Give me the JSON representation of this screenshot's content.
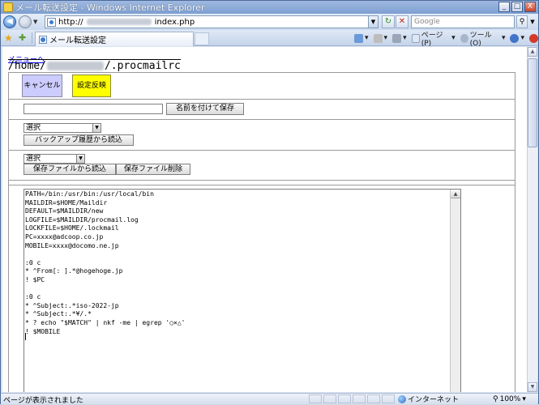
{
  "window": {
    "title": "メール転送設定 - Windows Internet Explorer",
    "controls": {
      "minimize": "_",
      "maximize": "□",
      "close": "X"
    }
  },
  "address_bar": {
    "url_prefix": "http://",
    "url_suffix": "index.php",
    "search_placeholder": "Google"
  },
  "tab": {
    "title": "メール転送設定"
  },
  "command_bar": {
    "page_label": "ページ(P)",
    "tools_label": "ツール(O)"
  },
  "page": {
    "menu_link": "メニューへ",
    "path_prefix": "/home/",
    "path_suffix": "/.procmailrc",
    "cancel_button": "キャンセル",
    "apply_button": "設定反映",
    "save_as_button": "名前を付けて保存",
    "backup_select_value": "選択",
    "backup_load_button": "バックアップ履歴から読込",
    "saved_select_value": "選択",
    "load_saved_button": "保存ファイルから読込",
    "delete_saved_button": "保存ファイル削除",
    "editor_content": "PATH=/bin:/usr/bin:/usr/local/bin\nMAILDIR=$HOME/Maildir\nDEFAULT=$MAILDIR/new\nLOGFILE=$MAILDIR/procmail.log\nLOCKFILE=$HOME/.lockmail\nPC=xxxx@adcoop.co.jp\nMOBILE=xxxx@docomo.ne.jp\n\n:0 c\n* ^From[: ].*@hogehoge.jp\n! $PC\n\n:0 c\n* ^Subject:.*iso-2022-jp\n* ^Subject:.*¥/.*\n* ? echo \"$MATCH\" | nkf -me | egrep '○×△'\n! $MOBILE"
  },
  "status_bar": {
    "status_text": "ページが表示されました",
    "zone_text": "インターネット",
    "zoom_text": "100%"
  }
}
